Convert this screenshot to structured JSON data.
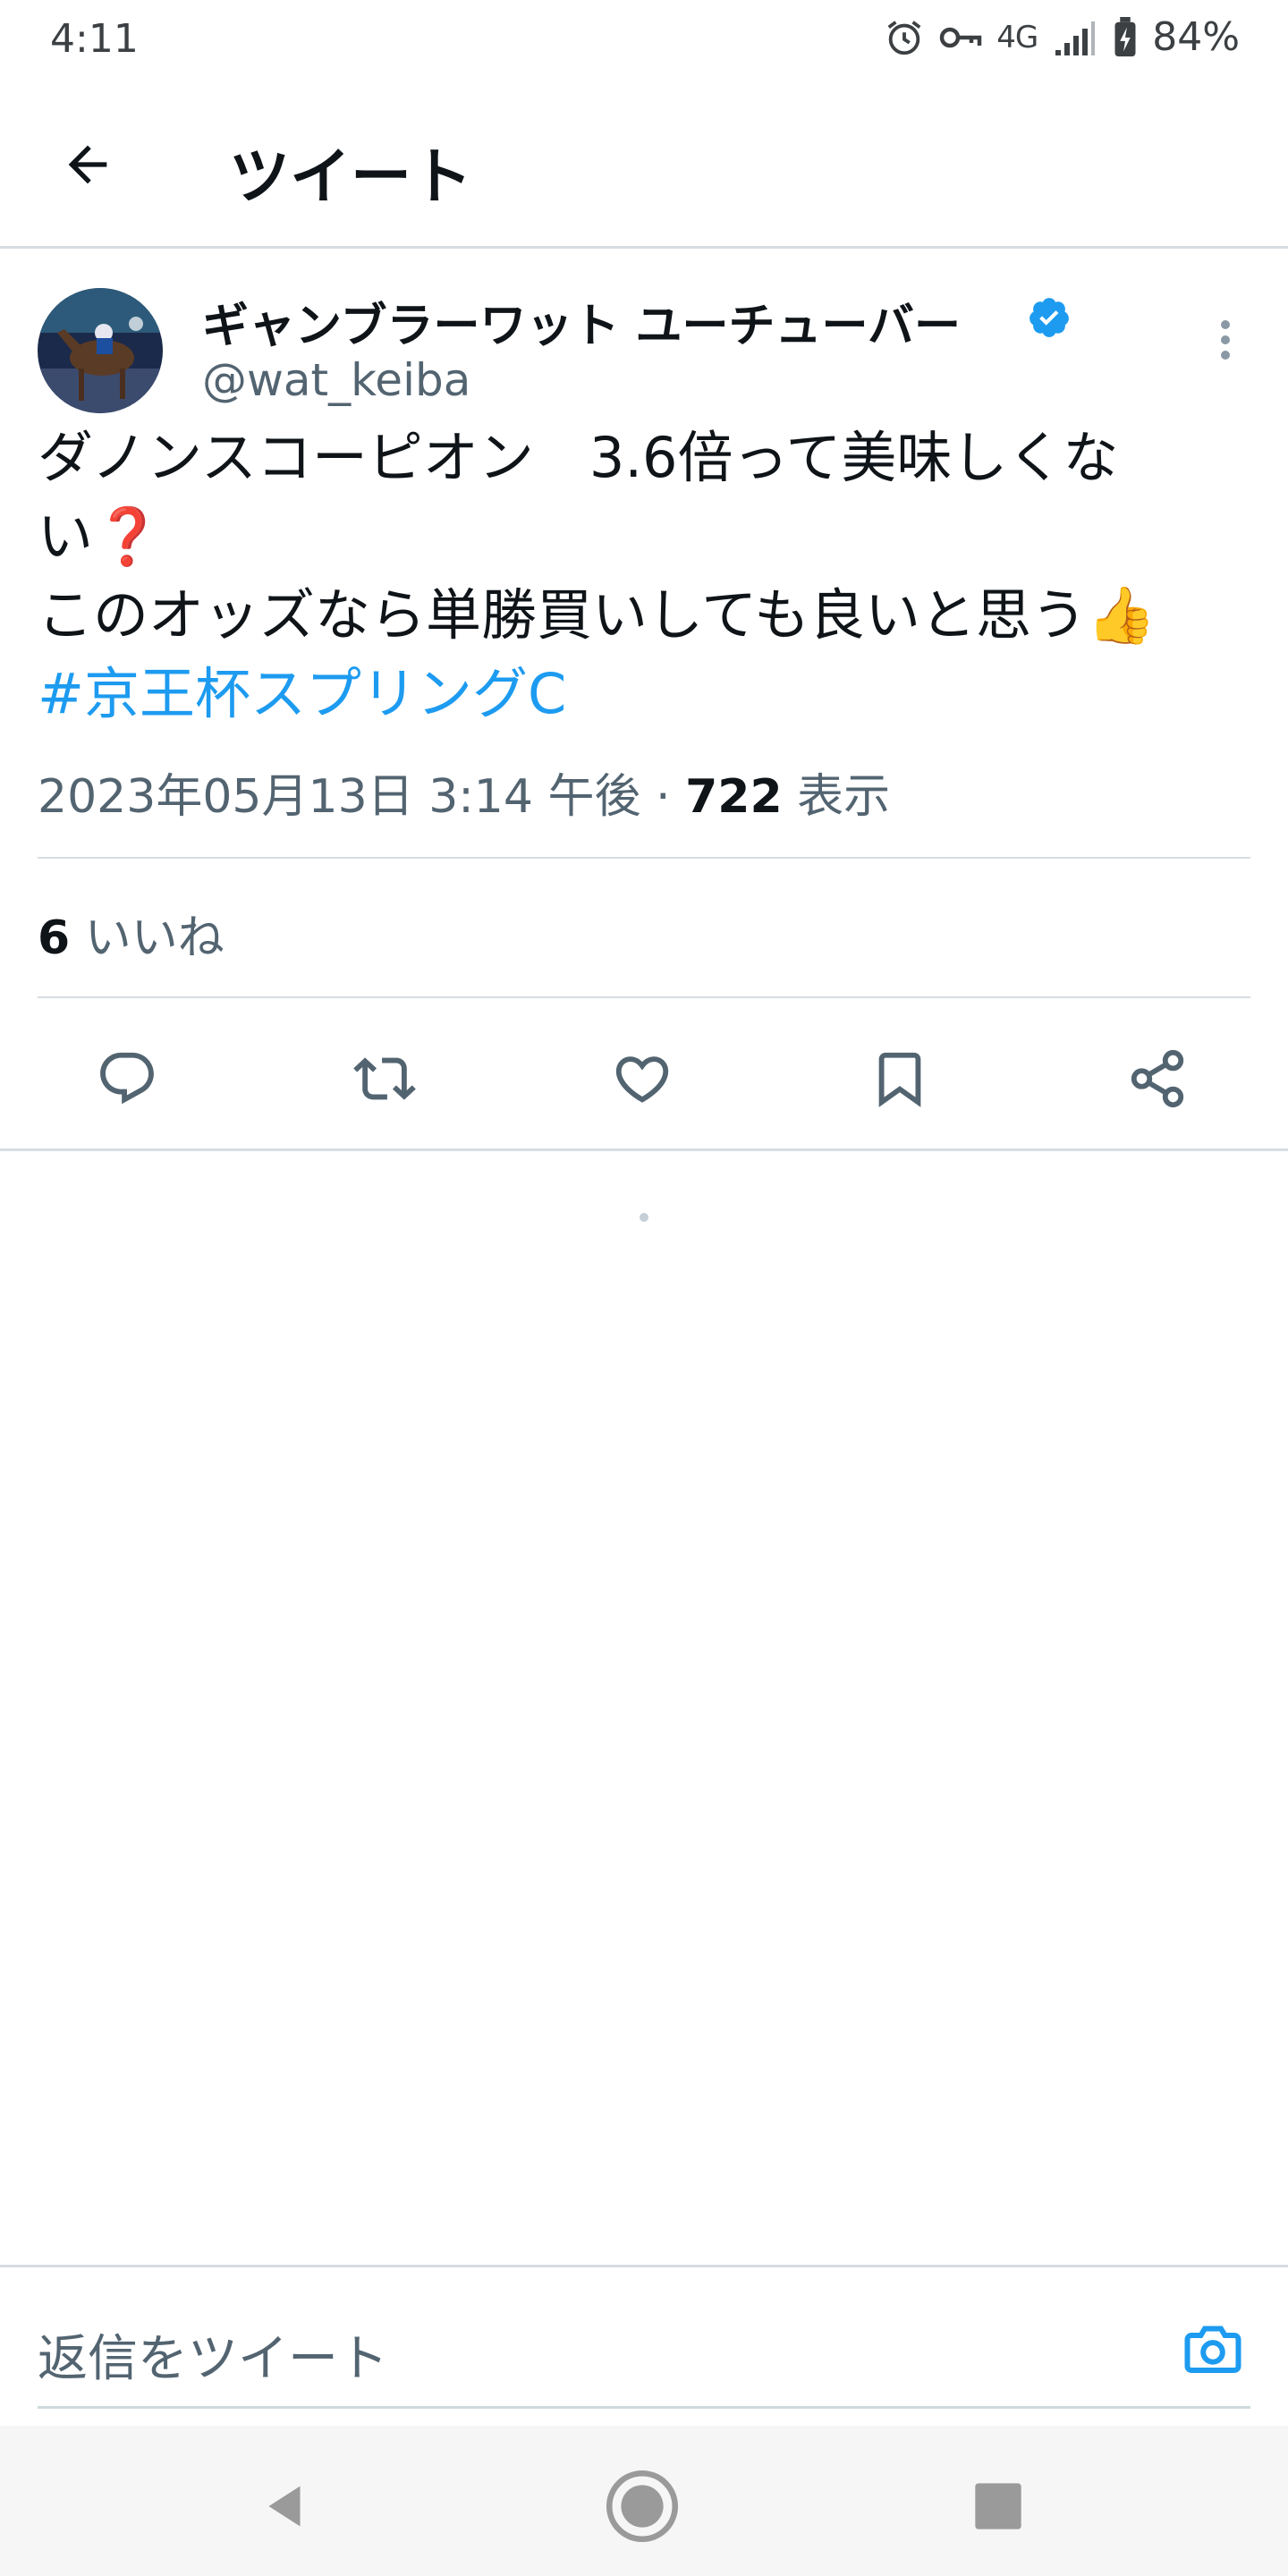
{
  "status_bar": {
    "time": "4:11",
    "network": "4G",
    "battery": "84%",
    "icons": [
      "alarm-icon",
      "vpn-key-icon",
      "signal-icon",
      "battery-icon"
    ]
  },
  "header": {
    "title": "ツイート",
    "back_icon": "arrow-left-icon"
  },
  "tweet": {
    "author_name": "ギャンブラーワット ユーチューバー",
    "handle": "@wat_keiba",
    "verified": true,
    "text_lines": [
      "ダノンスコーピオン　3.6倍って美味しくな",
      "い❓",
      "このオッズなら単勝買いしても良いと思う👍"
    ],
    "hashtag": "#京王杯スプリングC",
    "timestamp": "2023年05月13日 3:14 午後 · ",
    "views_count": "722",
    "views_label": " 表示",
    "likes_count": "6",
    "likes_label": " いいね"
  },
  "actions": [
    "reply-icon",
    "retweet-icon",
    "like-icon",
    "bookmark-icon",
    "share-icon"
  ],
  "reply_bar": {
    "placeholder": "返信をツイート",
    "camera_icon": "camera-icon"
  },
  "nav": [
    "back-triangle-icon",
    "home-circle-icon",
    "recents-square-icon"
  ],
  "colors": {
    "accent": "#1d9bf0",
    "text_primary": "#0f1419",
    "text_secondary": "#536471",
    "divider": "#d6dde3"
  }
}
